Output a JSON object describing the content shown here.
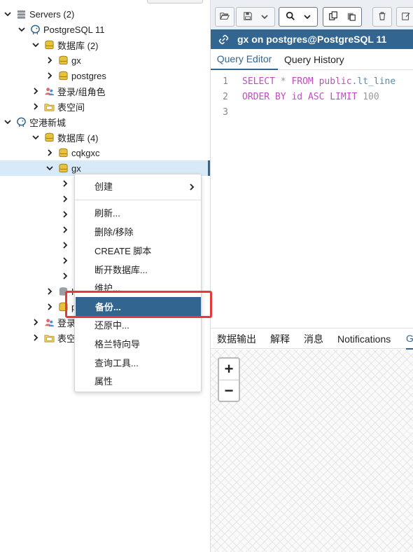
{
  "tree": {
    "servers_label": "Servers (2)",
    "server1_label": "PostgreSQL 11",
    "s1_databases_label": "数据库 (2)",
    "s1_db1_label": "gx",
    "s1_db2_label": "postgres",
    "s1_roles_label": "登录/组角色",
    "s1_tablespaces_label": "表空间",
    "server2_label": "空港新城",
    "s2_databases_label": "数据库 (4)",
    "s2_db1_label": "cqkgxc",
    "s2_db2_label": "gx",
    "s2_partial_a": "H",
    "s2_partial_b": "p",
    "s2_partial_roles": "登录",
    "s2_partial_tablespaces": "表空"
  },
  "context_menu": {
    "create": "创建",
    "refresh": "刷新...",
    "delete": "删除/移除",
    "create_script": "CREATE 脚本",
    "disconnect": "断开数据库...",
    "maintenance": "维护...",
    "backup": "备份...",
    "restore": "还原中...",
    "grant_wizard": "格兰特向导",
    "query_tool": "查询工具...",
    "properties": "属性"
  },
  "query": {
    "connection_title": "gx on postgres@PostgreSQL 11",
    "tab_editor": "Query Editor",
    "tab_history": "Query History",
    "line1_num": "1",
    "line2_num": "2",
    "line3_num": "3",
    "kw_select": "SELECT",
    "op_star": "*",
    "kw_from": "FROM",
    "schema": "public",
    "table": ".lt_line",
    "kw_order_by": "ORDER BY",
    "col": "id",
    "kw_asc": "ASC",
    "kw_limit": "LIMIT",
    "limit_val": "100"
  },
  "output_tabs": {
    "data_output": "数据输出",
    "explain": "解释",
    "messages": "消息",
    "notifications": "Notifications",
    "geometry_partial": "G"
  },
  "map": {
    "zoom_in": "+",
    "zoom_out": "−"
  },
  "colors": {
    "accent": "#326690",
    "highlight_box": "#e63a3a",
    "keyword": "#c24bc2"
  }
}
